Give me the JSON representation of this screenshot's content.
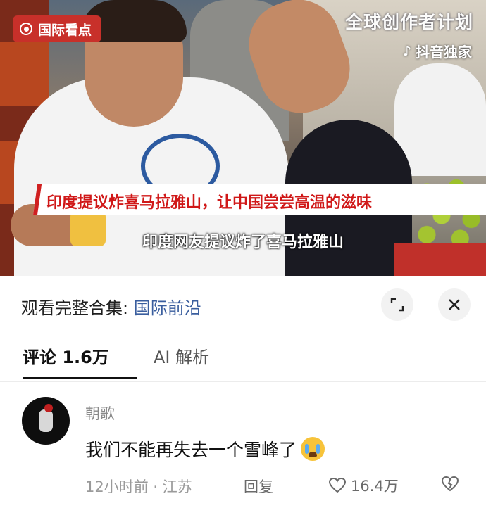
{
  "video": {
    "badge": "国际看点",
    "watermark_title": "全球创作者计划",
    "watermark_brand": "抖音独家",
    "headline": "印度提议炸喜马拉雅山，让中国尝尝高温的滋味",
    "subtitle": "印度网友提议炸了喜马拉雅山"
  },
  "panel": {
    "collection_prefix": "观看完整合集: ",
    "collection_link": "国际前沿",
    "tabs": [
      {
        "label": "评论 1.6万"
      },
      {
        "label": "AI 解析"
      }
    ],
    "comment": {
      "author": "朝歌",
      "text": "我们不能再失去一个雪峰了",
      "meta": "12小时前 · 江苏",
      "reply_label": "回复",
      "like_count": "16.4万"
    }
  },
  "colors": {
    "badge_red": "#c8302a",
    "headline_red": "#d01818",
    "link_blue": "#3a5e9e"
  }
}
